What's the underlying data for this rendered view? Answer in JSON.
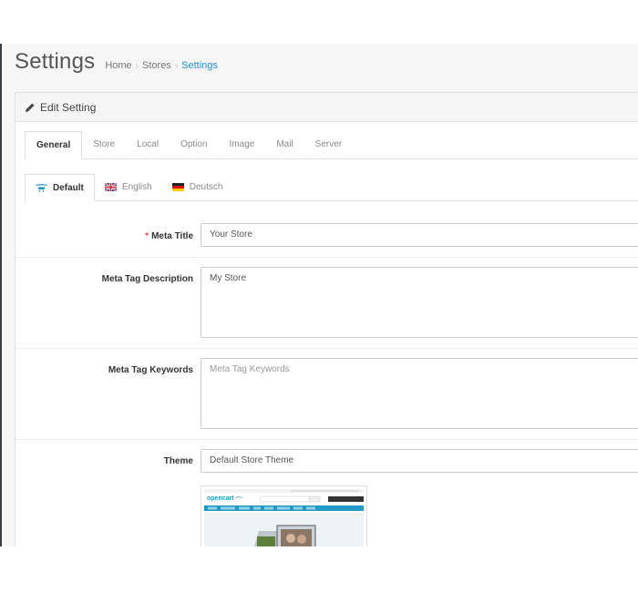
{
  "header": {
    "title": "Settings",
    "breadcrumb": [
      {
        "label": "Home"
      },
      {
        "label": "Stores"
      },
      {
        "label": "Settings"
      }
    ]
  },
  "panel": {
    "heading": "Edit Setting"
  },
  "tabs": [
    "General",
    "Store",
    "Local",
    "Option",
    "Image",
    "Mail",
    "Server"
  ],
  "active_tab": "General",
  "language_tabs": [
    {
      "label": "Default",
      "icon": "opencart-cart-icon"
    },
    {
      "label": "English",
      "icon": "uk-flag-icon"
    },
    {
      "label": "Deutsch",
      "icon": "germany-flag-icon"
    }
  ],
  "form": {
    "meta_title": {
      "label": "Meta Title",
      "required_mark": "*",
      "value": "Your Store"
    },
    "meta_description": {
      "label": "Meta Tag Description",
      "value": "My Store"
    },
    "meta_keywords": {
      "label": "Meta Tag Keywords",
      "value": "",
      "placeholder": "Meta Tag Keywords"
    },
    "theme": {
      "label": "Theme",
      "value": "Default Store Theme",
      "preview_logo": "opencart"
    }
  },
  "colors": {
    "link": "#1e91cf",
    "required": "#d9534f",
    "sidebar": "#3a3f44",
    "theme_nav": "#229ac8"
  }
}
